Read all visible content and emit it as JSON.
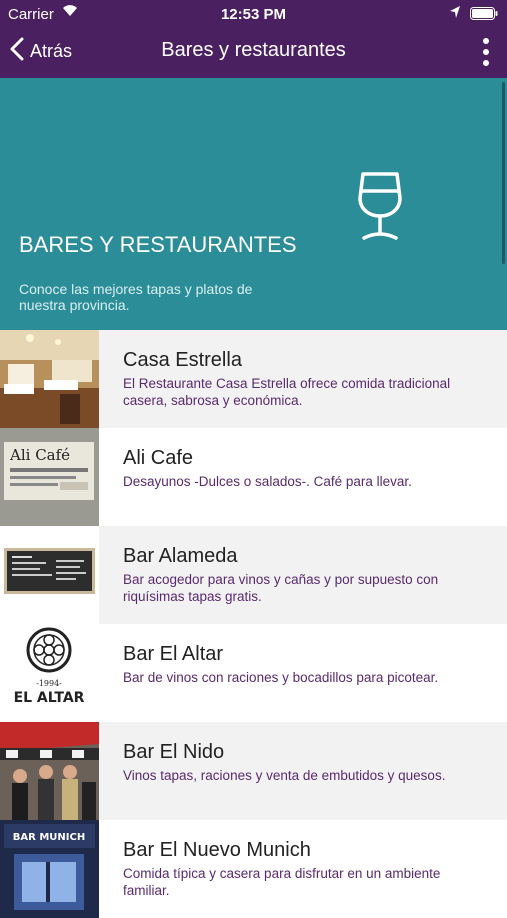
{
  "status_bar": {
    "carrier": "Carrier",
    "time": "12:53 PM"
  },
  "nav": {
    "back_label": "Atrás",
    "title": "Bares y restaurantes"
  },
  "hero": {
    "title": "Bares y restaurantes",
    "subtitle": "Conoce las mejores tapas y platos de nuestra provincia.",
    "icon": "wine-glass-icon"
  },
  "thumb_text": {
    "ali_sign": "Ali Café",
    "altar_year": "-1994-",
    "altar_name": "EL ALTAR",
    "munich_sign": "BAR MUNICH"
  },
  "places": [
    {
      "name": "Casa Estrella",
      "description": "El Restaurante Casa Estrella ofrece comida tradicional casera, sabrosa y económica."
    },
    {
      "name": "Ali Cafe",
      "description": "Desayunos -Dulces o salados-. Café para llevar."
    },
    {
      "name": "Bar Alameda",
      "description": "Bar acogedor para vinos y cañas y por supuesto con riquísimas tapas gratis."
    },
    {
      "name": "Bar El Altar",
      "description": "Bar de vinos con raciones y bocadillos para picotear."
    },
    {
      "name": "Bar El Nido",
      "description": "Vinos tapas, raciones y venta de embutidos y quesos."
    },
    {
      "name": "Bar El Nuevo Munich",
      "description": "Comida típica y casera para disfrutar en un ambiente familiar."
    }
  ],
  "colors": {
    "topbar": "#4a2060",
    "hero": "#2b8d98",
    "description_text": "#5a2a6e"
  }
}
